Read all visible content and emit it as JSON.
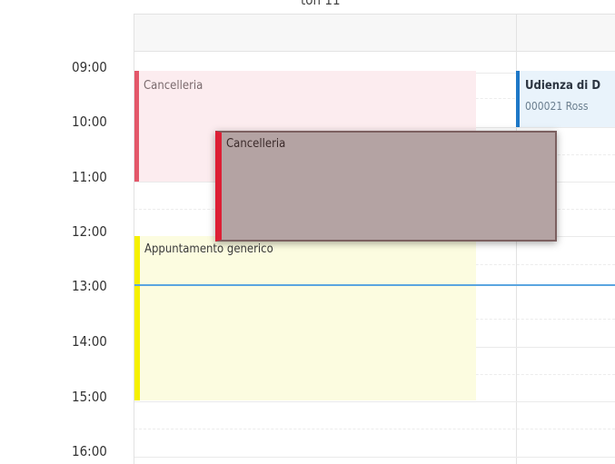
{
  "header": {
    "partial_date": "ton 11"
  },
  "time_slots": [
    "09:00",
    "10:00",
    "11:00",
    "12:00",
    "13:00",
    "14:00",
    "15:00",
    "16:00"
  ],
  "events": {
    "cancelleria_1": {
      "title": "Cancelleria",
      "color": "#e3576a"
    },
    "appuntamento": {
      "title": "Appuntamento generico",
      "color": "#f5f000"
    },
    "udienza": {
      "title": "Udienza di D",
      "subtitle": "000021 Ross",
      "color": "#1e78c7"
    },
    "dragging": {
      "title": "Cancelleria",
      "color": "#dd1f35"
    }
  },
  "current_time_color": "#5aa5e0"
}
